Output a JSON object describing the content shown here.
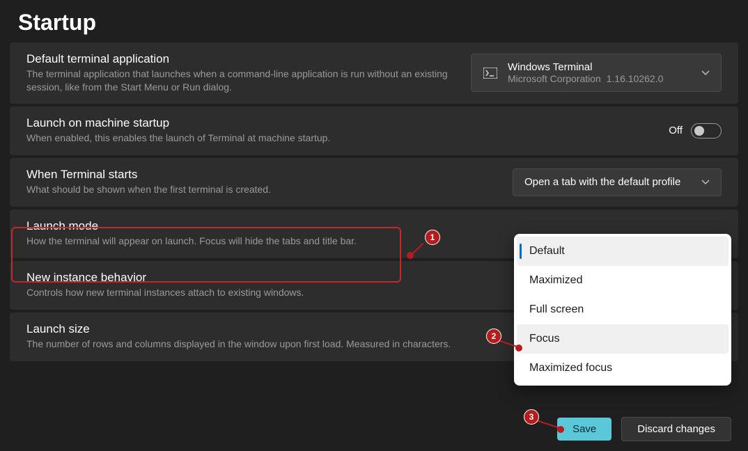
{
  "page": {
    "title": "Startup"
  },
  "rows": {
    "default_app": {
      "title": "Default terminal application",
      "desc": "The terminal application that launches when a command-line application is run without an existing session, like from the Start Menu or Run dialog.",
      "selected": {
        "name": "Windows Terminal",
        "publisher": "Microsoft Corporation",
        "version": "1.16.10262.0"
      }
    },
    "launch_startup": {
      "title": "Launch on machine startup",
      "desc": "When enabled, this enables the launch of Terminal at machine startup.",
      "toggle_label": "Off"
    },
    "when_starts": {
      "title": "When Terminal starts",
      "desc": "What should be shown when the first terminal is created.",
      "value": "Open a tab with the default profile"
    },
    "launch_mode": {
      "title": "Launch mode",
      "desc": "How the terminal will appear on launch. Focus will hide the tabs and title bar.",
      "options": [
        "Default",
        "Maximized",
        "Full screen",
        "Focus",
        "Maximized focus"
      ]
    },
    "new_instance": {
      "title": "New instance behavior",
      "desc": "Controls how new terminal instances attach to existing windows."
    },
    "launch_size": {
      "title": "Launch size",
      "desc": "The number of rows and columns displayed in the window upon first load. Measured in characters."
    }
  },
  "footer": {
    "save": "Save",
    "discard": "Discard changes"
  },
  "annotations": {
    "a1": "1",
    "a2": "2",
    "a3": "3"
  }
}
